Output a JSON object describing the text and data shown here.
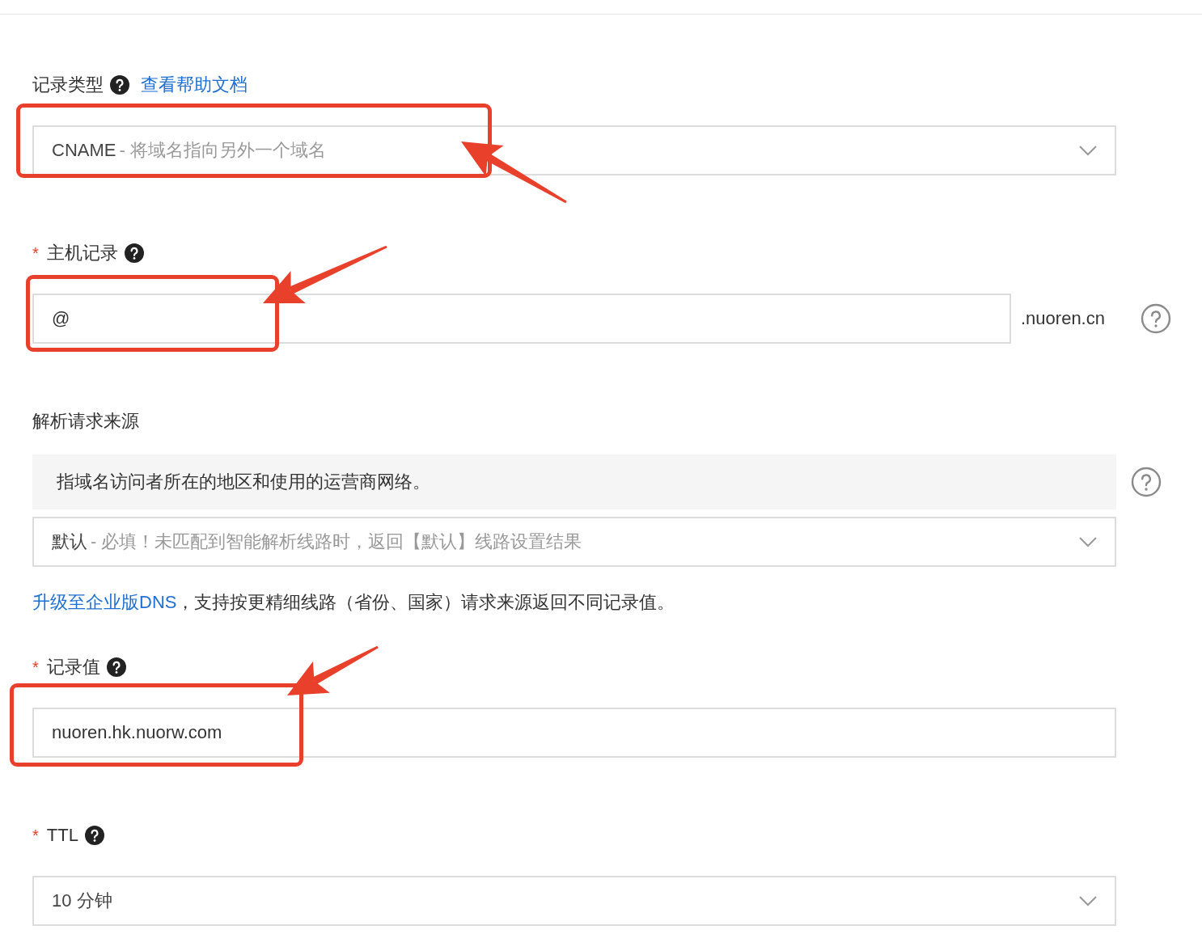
{
  "sections": [
    {
      "kind": "select",
      "label": "记录类型",
      "help": true,
      "link": "查看帮助文档",
      "value": "CNAME",
      "hint": "- 将域名指向另外一个域名",
      "annotated": true
    },
    {
      "kind": "input",
      "required_mark": "*",
      "label": "主机记录",
      "help": true,
      "value": "@",
      "suffix": ".nuoren.cn",
      "annotated": true
    },
    {
      "kind": "source",
      "label": "解析请求来源",
      "notice": "指域名访问者所在的地区和使用的运营商网络。",
      "value": "默认",
      "hint": "- 必填！未匹配到智能解析线路时，返回【默认】线路设置结果",
      "footnote_link": "升级至企业版DNS",
      "footnote": "，支持按更精细线路（省份、国家）请求来源返回不同记录值。"
    },
    {
      "kind": "input",
      "required_mark": "*",
      "label": "记录值",
      "help": true,
      "value": "nuoren.hk.nuorw.com",
      "annotated": true
    },
    {
      "kind": "select",
      "required_mark": "*",
      "label": "TTL",
      "help": true,
      "value": "10 分钟"
    }
  ]
}
